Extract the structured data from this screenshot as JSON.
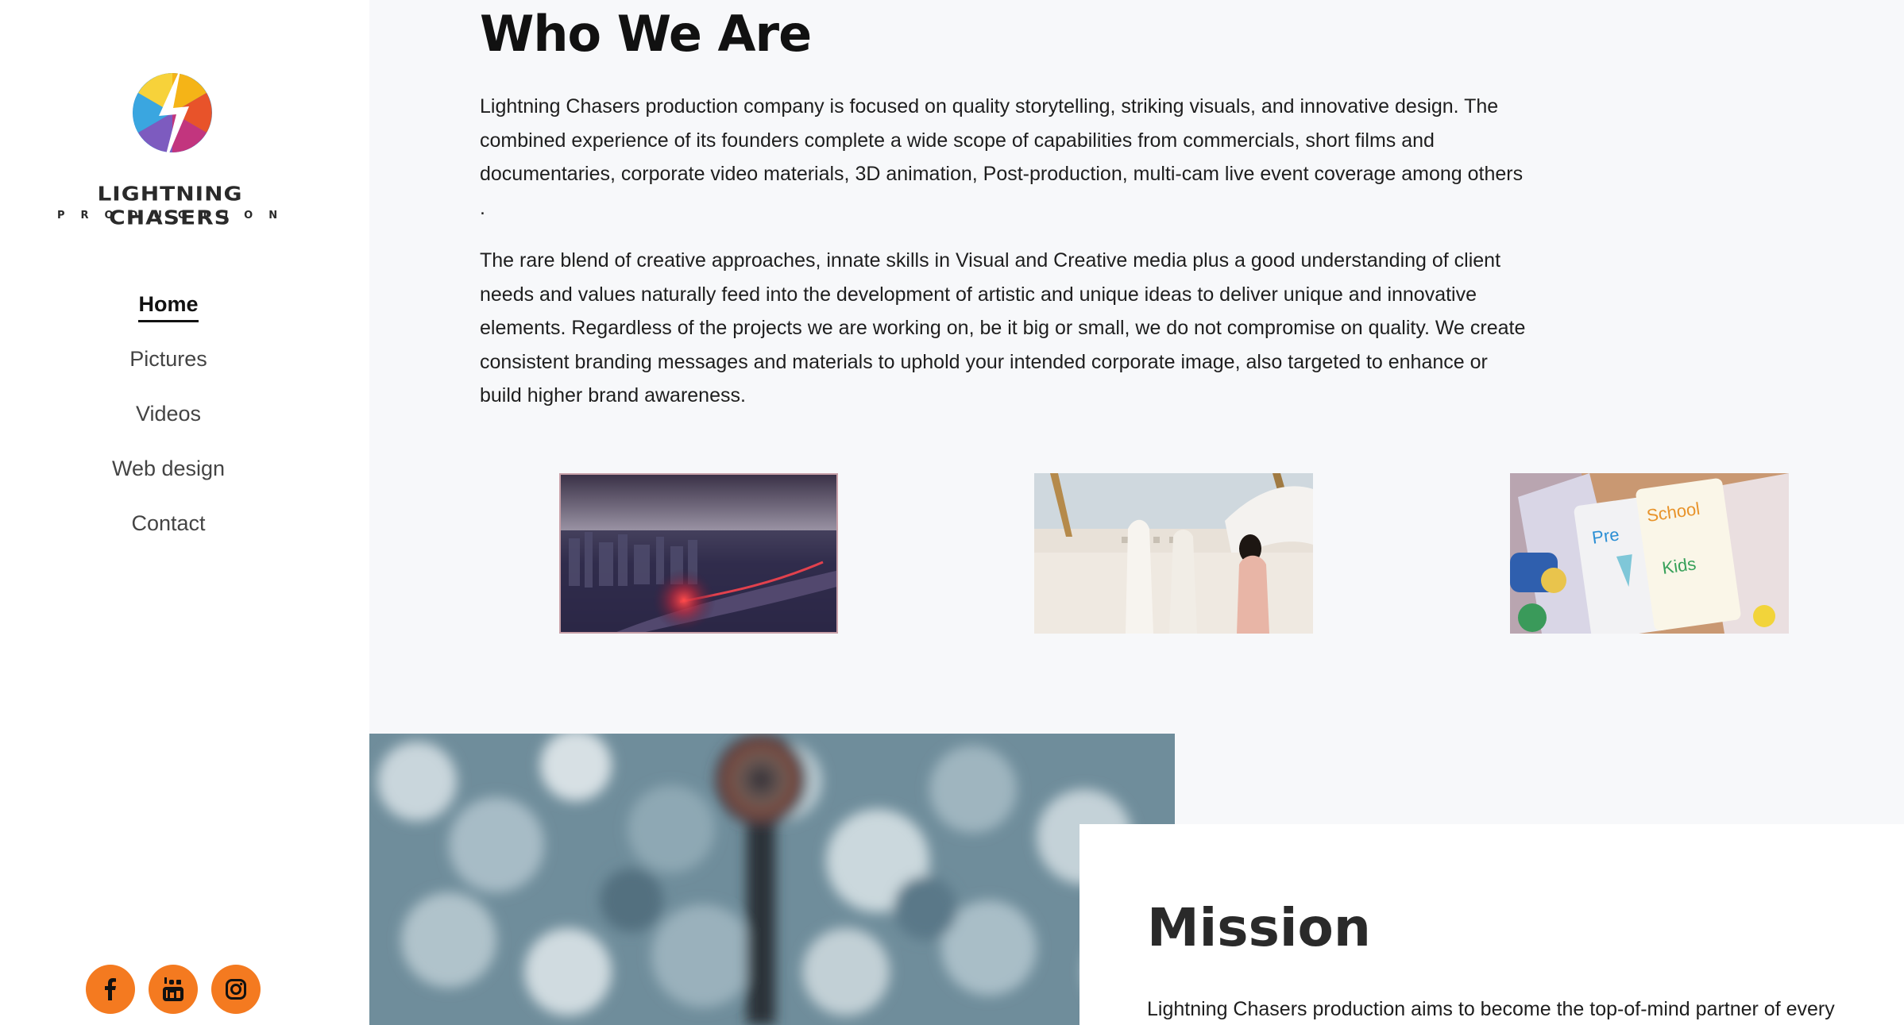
{
  "brand": {
    "name": "LIGHTNING CHASERS",
    "tagline": "PRODUCTION",
    "accent_color": "#f47a20"
  },
  "nav": {
    "items": [
      {
        "label": "Home",
        "active": true
      },
      {
        "label": "Pictures",
        "active": false
      },
      {
        "label": "Videos",
        "active": false
      },
      {
        "label": "Web design",
        "active": false
      },
      {
        "label": "Contact",
        "active": false
      }
    ]
  },
  "social": {
    "icons": [
      "facebook-icon",
      "youtube-icon",
      "instagram-icon"
    ]
  },
  "about": {
    "heading": "Who We Are",
    "paragraph_1": "Lightning Chasers production company is focused on quality storytelling, striking visuals, and innovative design. The combined experience of its founders complete a wide scope of capabilities from commercials, short films and documentaries, corporate video materials, 3D animation, Post-production, multi-cam live event coverage among others .",
    "paragraph_2": "The rare blend of creative approaches, innate skills in Visual and Creative media plus a good understanding of client needs and values naturally feed into the development of artistic and unique ideas to deliver unique and innovative elements. Regardless of the projects we are working on, be it big or small, we do not compromise on quality. We create consistent branding messages and materials to uphold your intended corporate image, also targeted to enhance or build higher brand awareness."
  },
  "thumbnails": {
    "pre_label": "Pre",
    "school_label": "School",
    "kids_label": "Kids"
  },
  "mission": {
    "heading": "Mission",
    "text": "Lightning Chasers production aims to become the top-of-mind partner of every"
  }
}
